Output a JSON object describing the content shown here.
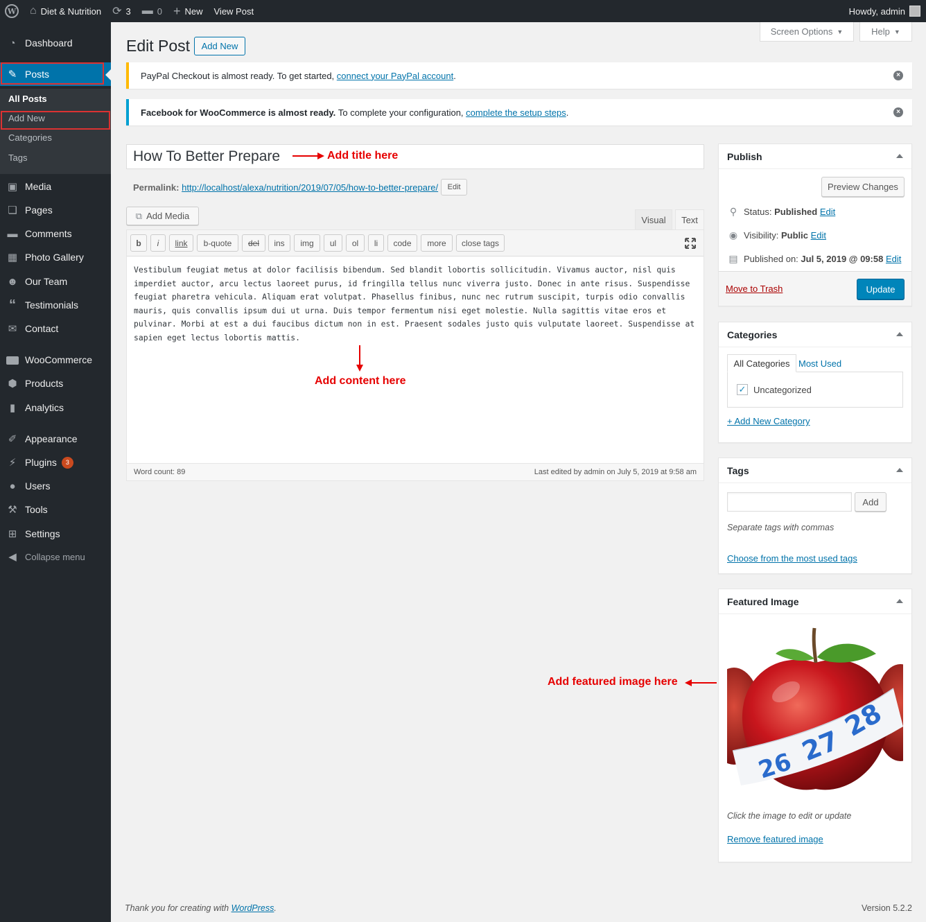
{
  "adminbar": {
    "site_name": "Diet & Nutrition",
    "updates_count": "3",
    "comments_count": "0",
    "new_label": "New",
    "view_post_label": "View Post",
    "howdy": "Howdy, admin"
  },
  "sidebar": {
    "items": {
      "dashboard": "Dashboard",
      "posts": "Posts",
      "media": "Media",
      "pages": "Pages",
      "comments": "Comments",
      "photo_gallery": "Photo Gallery",
      "our_team": "Our Team",
      "testimonials": "Testimonials",
      "contact": "Contact",
      "woocommerce": "WooCommerce",
      "products": "Products",
      "analytics": "Analytics",
      "appearance": "Appearance",
      "plugins": "Plugins",
      "plugins_badge": "3",
      "users": "Users",
      "tools": "Tools",
      "settings": "Settings",
      "collapse": "Collapse menu"
    },
    "submenu": {
      "all_posts": "All Posts",
      "add_new": "Add New",
      "categories": "Categories",
      "tags": "Tags"
    }
  },
  "header": {
    "title": "Edit Post",
    "add_new": "Add New",
    "screen_options": "Screen Options",
    "help": "Help"
  },
  "notices": {
    "paypal_text": "PayPal Checkout is almost ready. To get started,",
    "paypal_link": "connect your PayPal account",
    "fb_bold": "Facebook for WooCommerce is almost ready.",
    "fb_text": "To complete your configuration,",
    "fb_link": "complete the setup steps"
  },
  "post": {
    "title": "How To Better Prepare",
    "permalink_label": "Permalink:",
    "permalink_url": "http://localhost/alexa/nutrition/2019/07/05/how-to-better-prepare/",
    "edit_label": "Edit",
    "content": "Vestibulum feugiat metus at dolor facilisis bibendum. Sed blandit lobortis sollicitudin. Vivamus auctor, nisl quis imperdiet auctor, arcu lectus laoreet purus, id fringilla tellus nunc viverra justo. Donec in ante risus. Suspendisse feugiat pharetra vehicula. Aliquam erat volutpat. Phasellus finibus, nunc nec rutrum suscipit, turpis odio convallis mauris, quis convallis ipsum dui ut urna. Duis tempor fermentum nisi eget molestie. Nulla sagittis vitae eros et pulvinar. Morbi at est a dui faucibus dictum non in est. Praesent sodales justo quis vulputate laoreet. Suspendisse at sapien eget lectus lobortis mattis.",
    "word_count": "Word count: 89",
    "last_edited": "Last edited by admin on July 5, 2019 at 9:58 am"
  },
  "editor": {
    "add_media": "Add Media",
    "tab_visual": "Visual",
    "tab_text": "Text",
    "buttons": [
      "b",
      "i",
      "link",
      "b-quote",
      "del",
      "ins",
      "img",
      "ul",
      "ol",
      "li",
      "code",
      "more",
      "close tags"
    ]
  },
  "annotations": {
    "title": "Add title here",
    "content": "Add content here",
    "featured": "Add featured image here"
  },
  "publish": {
    "heading": "Publish",
    "preview": "Preview Changes",
    "status_label": "Status:",
    "status_value": "Published",
    "visibility_label": "Visibility:",
    "visibility_value": "Public",
    "published_label": "Published on:",
    "published_value": "Jul 5, 2019 @ 09:58",
    "edit": "Edit",
    "trash": "Move to Trash",
    "update": "Update"
  },
  "categories": {
    "heading": "Categories",
    "tab_all": "All Categories",
    "tab_most": "Most Used",
    "item": "Uncategorized",
    "add_new": "+ Add New Category"
  },
  "tags": {
    "heading": "Tags",
    "add": "Add",
    "hint": "Separate tags with commas",
    "choose": "Choose from the most used tags"
  },
  "featured": {
    "heading": "Featured Image",
    "hint": "Click the image to edit or update",
    "remove": "Remove featured image",
    "tape_numbers": [
      "26",
      "27",
      "28"
    ]
  },
  "footer": {
    "thanks": "Thank you for creating with",
    "wp_link": "WordPress",
    "version": "Version 5.2.2"
  },
  "colors": {
    "accent": "#0073aa",
    "annotation": "#e60000",
    "admin_bg": "#23282d",
    "notice_warning": "#ffb900",
    "notice_info": "#00a0d2"
  }
}
